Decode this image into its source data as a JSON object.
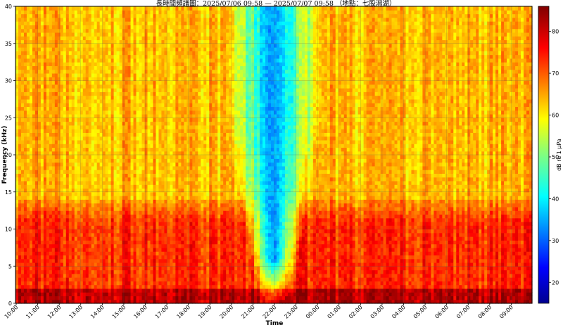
{
  "chart_data": {
    "type": "heatmap",
    "title": "長時間頻譜圖：2025/07/06 09:58 — 2025/07/07 09:58 （地點：七股潟湖）",
    "xlabel": "Time",
    "ylabel": "Frequency (kHz)",
    "x_ticks": [
      "10:00",
      "11:00",
      "12:00",
      "13:00",
      "14:00",
      "15:00",
      "16:00",
      "17:00",
      "18:00",
      "19:00",
      "20:00",
      "21:00",
      "22:00",
      "23:00",
      "00:00",
      "01:00",
      "02:00",
      "03:00",
      "04:00",
      "05:00",
      "06:00",
      "07:00",
      "08:00",
      "09:00"
    ],
    "x_range_hours": [
      9.967,
      33.967
    ],
    "y_ticks": [
      0,
      5,
      10,
      15,
      20,
      25,
      30,
      35,
      40
    ],
    "ylim": [
      0,
      40
    ],
    "colorbar": {
      "label": "dB re 1 µPa",
      "ticks": [
        20,
        30,
        40,
        50,
        60,
        70,
        80
      ],
      "range": [
        15,
        86
      ],
      "colormap": "jet"
    },
    "grid": true,
    "features": {
      "quiet_notch": {
        "start": "19:45",
        "end": "00:15",
        "min_level_db": 38
      },
      "low_freq_band_khz": [
        0,
        14
      ],
      "low_freq_level_db": 74,
      "high_freq_level_db": 64
    }
  }
}
